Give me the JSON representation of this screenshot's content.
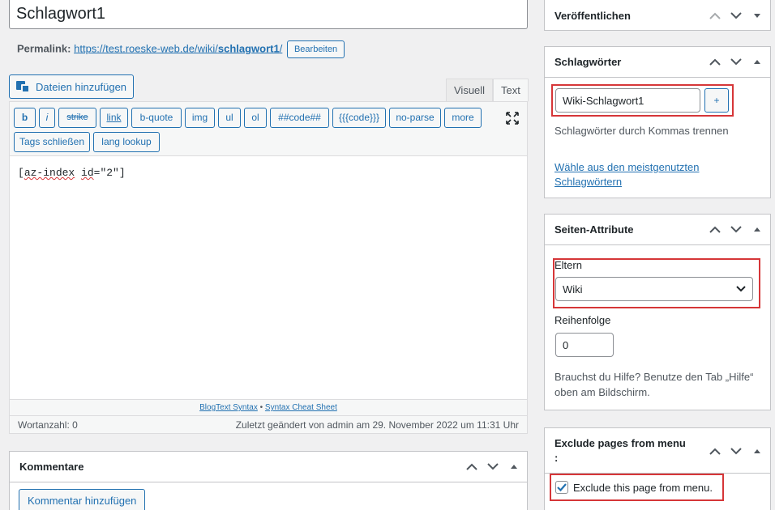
{
  "editor": {
    "post_title": "Schlagwort1",
    "permalink_label": "Permalink:",
    "permalink_url_prefix": "https://test.roeske-web.de/wiki/",
    "permalink_slug": "schlagwort1",
    "permalink_url_suffix": "/",
    "edit_permalink_label": "Bearbeiten",
    "add_media_label": "Dateien hinzufügen",
    "tabs": {
      "visual": "Visuell",
      "text": "Text"
    },
    "quicktags": [
      "b",
      "i",
      "strike",
      "link",
      "b-quote",
      "img",
      "ul",
      "ol",
      "##code##",
      "{{{code}}}",
      "no-parse",
      "more",
      "Tags schließen",
      "lang lookup"
    ],
    "content_prefix": "[",
    "content_word1": "az-index",
    "content_space": " ",
    "content_word2": "id",
    "content_suffix": "=\"2\"]",
    "blogtext_link1": "BlogText Syntax",
    "blogtext_sep": " • ",
    "blogtext_link2": "Syntax Cheat Sheet",
    "word_count": "Wortanzahl: 0",
    "last_modified": "Zuletzt geändert von admin am 29. November 2022 um 11:31 Uhr"
  },
  "comments": {
    "title": "Kommentare",
    "add_comment_label": "Kommentar hinzufügen"
  },
  "sidebar": {
    "publish_title": "Veröffentlichen",
    "tags": {
      "title": "Schlagwörter",
      "input_value": "Wiki-Schlagwort1",
      "add_label": "+",
      "hint": "Schlagwörter durch Kommas trennen",
      "most_used_line1": "Wähle aus den meistgenutzten",
      "most_used_line2": "Schlagwörtern"
    },
    "attributes": {
      "title": "Seiten-Attribute",
      "parent_label": "Eltern",
      "parent_value": "Wiki",
      "order_label": "Reihenfolge",
      "order_value": "0",
      "help_line1": "Brauchst du Hilfe? Benutze den Tab „Hilfe“",
      "help_line2": "oben am Bildschirm."
    },
    "exclude": {
      "title_line1": "Exclude pages from menu",
      "title_line2": ":",
      "checkbox_label": "Exclude this page from menu.",
      "checked": true
    }
  },
  "colors": {
    "accent": "#2271b1",
    "highlight_red": "#d63638"
  }
}
